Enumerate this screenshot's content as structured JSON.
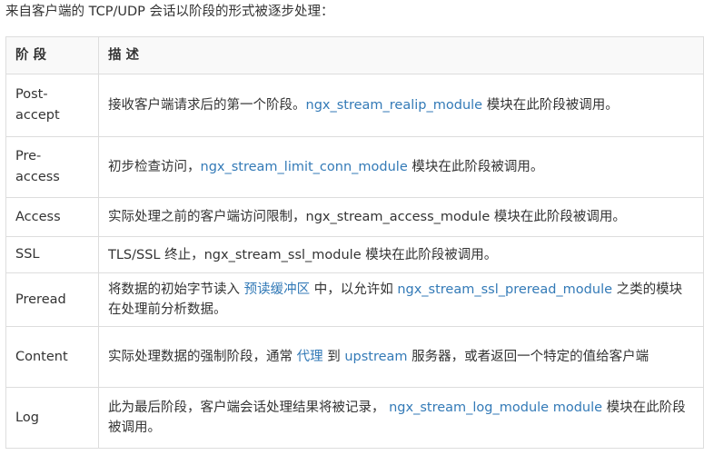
{
  "intro": "来自客户端的 TCP/UDP 会话以阶段的形式被逐步处理：",
  "headers": {
    "phase": "阶 段",
    "desc": "描 述"
  },
  "rows": {
    "post": {
      "name": "Post-accept",
      "t1": "接收客户端请求后的第一个阶段。",
      "link1": "ngx_stream_realip_module",
      "t2": " 模块在此阶段被调用。"
    },
    "pre": {
      "name": "Pre-access",
      "t1": "初步检查访问，",
      "link1": "ngx_stream_limit_conn_module",
      "t2": " 模块在此阶段被调用。"
    },
    "access": {
      "name": "Access",
      "t1": "实际处理之前的客户端访问限制，ngx_stream_access_module 模块在此阶段被调用。"
    },
    "ssl": {
      "name": "SSL",
      "t1": "TLS/SSL 终止，ngx_stream_ssl_module 模块在此阶段被调用。"
    },
    "preread": {
      "name": "Preread",
      "t1": "将数据的初始字节读入 ",
      "link1": "预读缓冲区",
      "t2": " 中，以允许如 ",
      "link2": "ngx_stream_ssl_preread_module",
      "t3": " 之类的模块在处理前分析数据。"
    },
    "content": {
      "name": "Content",
      "t1": "实际处理数据的强制阶段，通常 ",
      "link1": "代理",
      "t2": " 到 ",
      "link2": "upstream",
      "t3": " 服务器，或者返回一个特定的值给客户端"
    },
    "log": {
      "name": "Log",
      "t1": "此为最后阶段，客户端会话处理结果将被记录， ",
      "link1": "ngx_stream_log_module module",
      "t2": " 模块在此阶段被调用。"
    }
  },
  "colors": {
    "link": "#337ab7",
    "text": "#333333",
    "border": "#dddddd",
    "header_bg": "#f9f9f9"
  }
}
